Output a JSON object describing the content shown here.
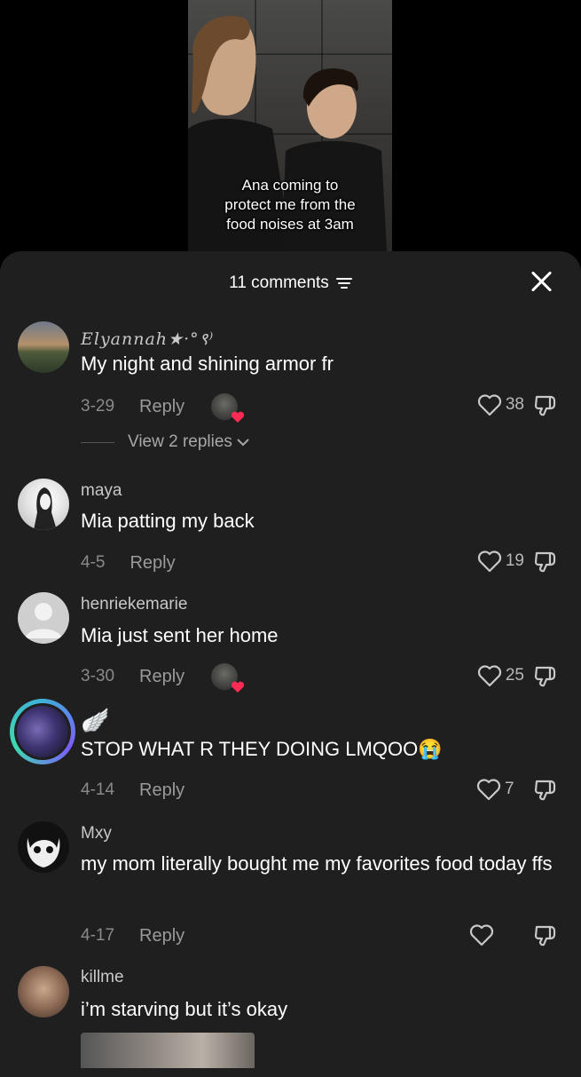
{
  "video": {
    "caption_lines": [
      "Ana coming to",
      "protect me from the",
      "food noises at 3am"
    ]
  },
  "header": {
    "comment_count": "11 comments"
  },
  "comments": [
    {
      "username": "Elyannah★·°९⁾",
      "text": "My night and shining armor fr",
      "date": "3-29",
      "reply_label": "Reply",
      "likes": "38",
      "view_replies": "View 2 replies"
    },
    {
      "username": "maya",
      "text": "Mia patting my back",
      "date": "4-5",
      "reply_label": "Reply",
      "likes": "19"
    },
    {
      "username": "henriekemarie",
      "text": "Mia just sent her home",
      "date": "3-30",
      "reply_label": "Reply",
      "likes": "25"
    },
    {
      "username": "🪽",
      "text": "STOP WHAT R THEY DOING LMQOO😭",
      "date": "4-14",
      "reply_label": "Reply",
      "likes": "7"
    },
    {
      "username": "Mxy",
      "text": "my mom literally bought me my favorites food today ffs",
      "date": "4-17",
      "reply_label": "Reply",
      "likes": ""
    },
    {
      "username": "killme",
      "text": "i’m starving but it’s okay"
    }
  ],
  "icons": {
    "close": "close-icon",
    "filter": "filter-icon",
    "like": "heart-icon",
    "dislike": "dislike-icon",
    "chevron": "chevron-down-icon"
  },
  "colors": {
    "sheet_bg": "#1f1f1f",
    "creator_heart": "#fe2c55",
    "story_ring": "#3fb0d8"
  }
}
